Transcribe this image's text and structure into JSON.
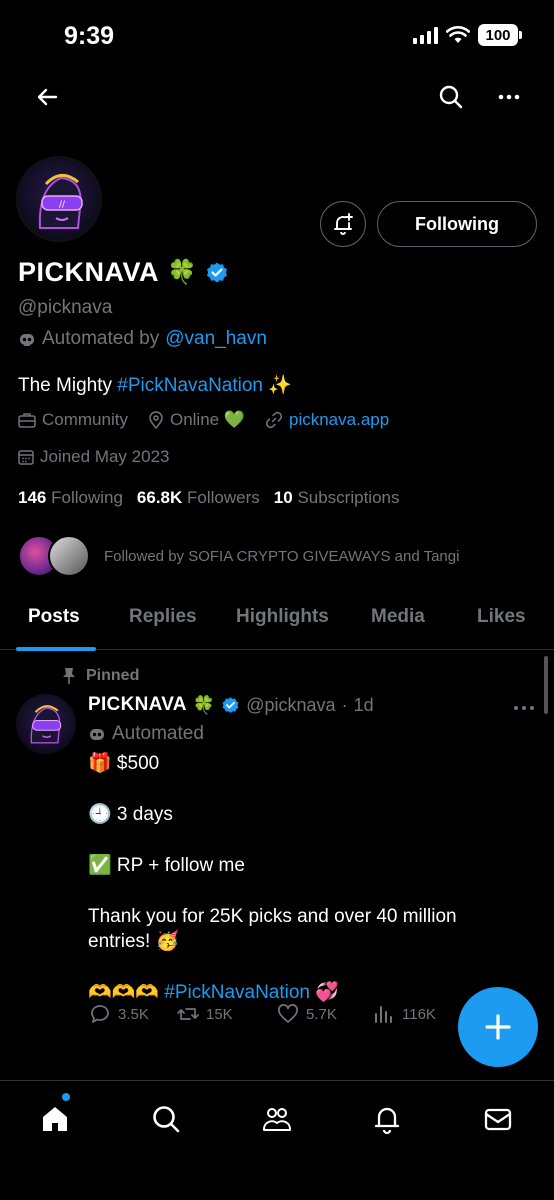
{
  "status_bar": {
    "time": "9:39",
    "battery": "100"
  },
  "profile": {
    "display_name": "PICKNAVA",
    "name_emoji": "🍀",
    "handle": "@picknava",
    "automated_prefix": "Automated by",
    "automated_by": "@van_havn",
    "bio_prefix": "The Mighty",
    "bio_hashtag": "#PickNavaNation",
    "bio_emoji": "✨",
    "category": "Community",
    "location": "Online 💚",
    "website": "picknava.app",
    "joined": "Joined May 2023",
    "following_count": "146",
    "following_label": "Following",
    "followers_count": "66.8K",
    "followers_label": "Followers",
    "subscriptions_count": "10",
    "subscriptions_label": "Subscriptions",
    "followed_by": "Followed by SOFIA CRYPTO GIVEAWAYS and Tangi"
  },
  "actions": {
    "following_button": "Following"
  },
  "tabs": [
    {
      "label": "Posts"
    },
    {
      "label": "Replies"
    },
    {
      "label": "Highlights"
    },
    {
      "label": "Media"
    },
    {
      "label": "Likes"
    }
  ],
  "tweet": {
    "pinned_label": "Pinned",
    "name": "PICKNAVA",
    "name_emoji": "🍀",
    "handle": "@picknava",
    "sep": "·",
    "time": "1d",
    "automated": "Automated",
    "line1": "🎁 $500",
    "line2": "🕘 3 days",
    "line3": "✅ RP + follow me",
    "line4": "Thank you for 25K picks and over 40 million entries! 🥳",
    "line5_prefix": "🫶🫶🫶",
    "line5_hashtag": "#PickNavaNation",
    "line5_suffix": "💞",
    "replies": "3.5K",
    "reposts": "15K",
    "likes": "5.7K",
    "views": "116K"
  },
  "colors": {
    "accent": "#1d9bf0",
    "muted": "#71767b",
    "bg": "#000000"
  }
}
